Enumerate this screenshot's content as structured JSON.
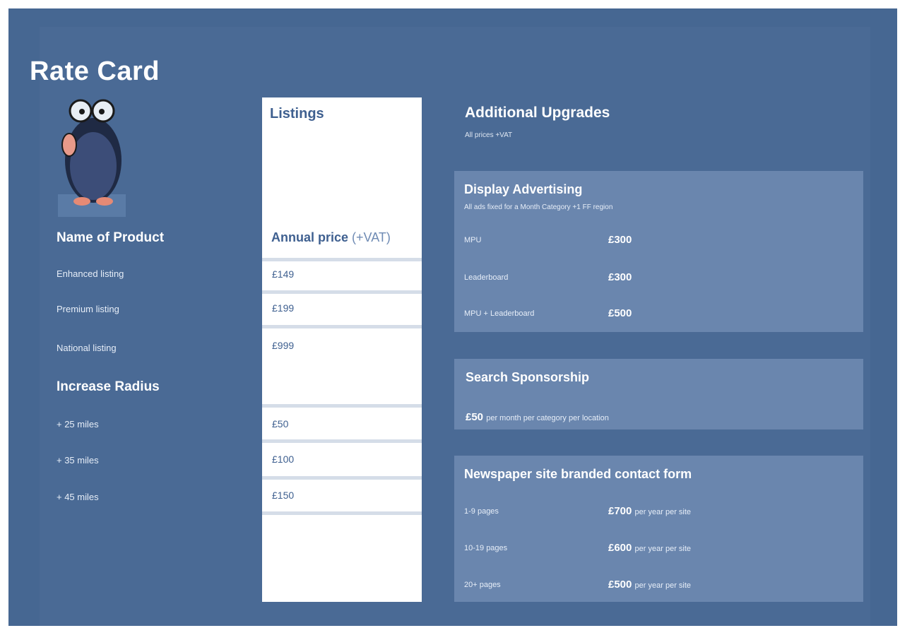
{
  "page": {
    "title": "Rate Card"
  },
  "products": {
    "heading": "Name of Product",
    "items": [
      "Enhanced listing",
      "Premium listing",
      "National listing"
    ]
  },
  "radius": {
    "heading": "Increase Radius",
    "items": [
      "+ 25 miles",
      "+ 35 miles",
      "+ 45 miles"
    ]
  },
  "listings": {
    "heading": "Listings",
    "price_heading": "Annual price",
    "price_suffix": "(+VAT)",
    "prices": [
      "£149",
      "£199",
      "£999",
      "£50",
      "£100",
      "£150"
    ]
  },
  "upgrades": {
    "heading": "Additional Upgrades",
    "subheading": "All prices +VAT"
  },
  "display_ads": {
    "heading": "Display Advertising",
    "subheading": "All ads fixed for a Month Category +1 FF region",
    "rows": [
      {
        "label": "MPU",
        "price": "£300"
      },
      {
        "label": "Leaderboard",
        "price": "£300"
      },
      {
        "label": "MPU + Leaderboard",
        "price": "£500"
      }
    ]
  },
  "sponsorship": {
    "heading": "Search Sponsorship",
    "price": "£50",
    "suffix": "per month per category per location"
  },
  "contact_form": {
    "heading": "Newspaper site branded contact form",
    "rows": [
      {
        "label": "1-9 pages",
        "price": "£700",
        "suffix": "per year per site"
      },
      {
        "label": "10-19 pages",
        "price": "£600",
        "suffix": "per year per site"
      },
      {
        "label": "20+ pages",
        "price": "£500",
        "suffix": "per year per site"
      }
    ]
  },
  "colors": {
    "background": "#466792",
    "panel": "#6a86ae",
    "listing_text": "#3f6090"
  },
  "icons": {
    "mascot": "penguin-mascot-icon"
  }
}
